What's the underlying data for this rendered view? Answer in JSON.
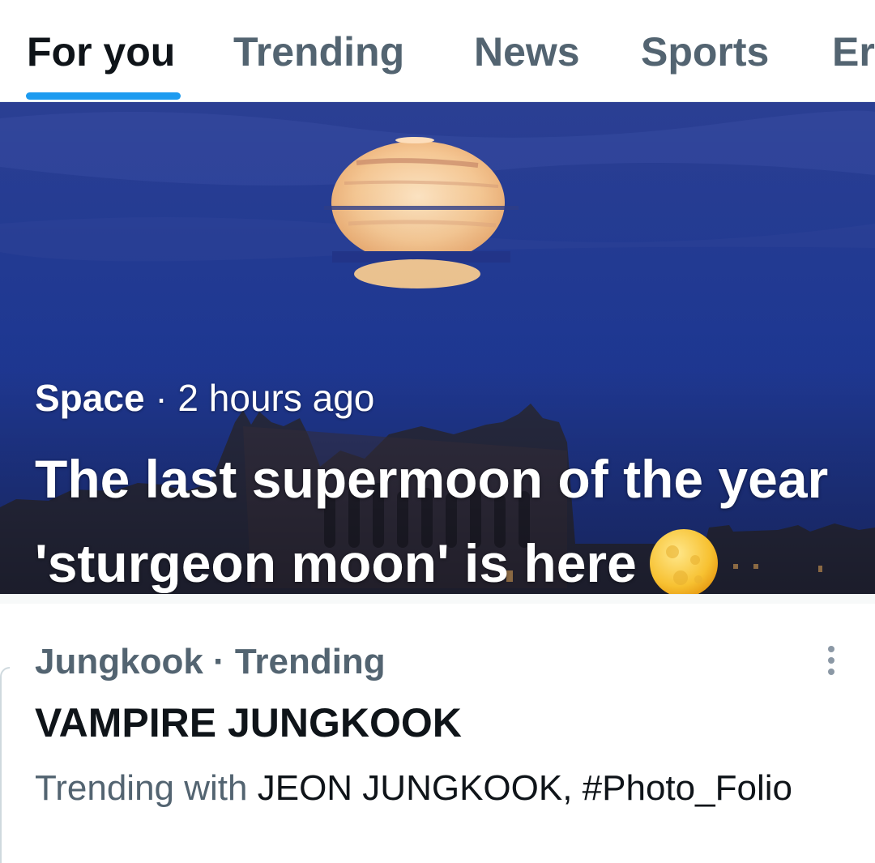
{
  "tabs": [
    {
      "label": "For you",
      "active": true
    },
    {
      "label": "Trending",
      "active": false
    },
    {
      "label": "News",
      "active": false
    },
    {
      "label": "Sports",
      "active": false
    },
    {
      "label": "Er",
      "active": false
    }
  ],
  "hero": {
    "category": "Space",
    "separator": "·",
    "time": "2 hours ago",
    "title": "The last supermoon of the year 'sturgeon moon' is here",
    "emoji_icon": "full-moon-icon"
  },
  "trend": {
    "context": "Jungkook · Trending",
    "title": "VAMPIRE JUNGKOOK",
    "with_prefix": "Trending with",
    "with_names": "JEON JUNGKOOK, #Photo_Folio",
    "menu_icon": "more-vertical-icon"
  },
  "colors": {
    "accent": "#1d9bf0",
    "text_primary": "#0f1419",
    "text_secondary": "#536471"
  }
}
